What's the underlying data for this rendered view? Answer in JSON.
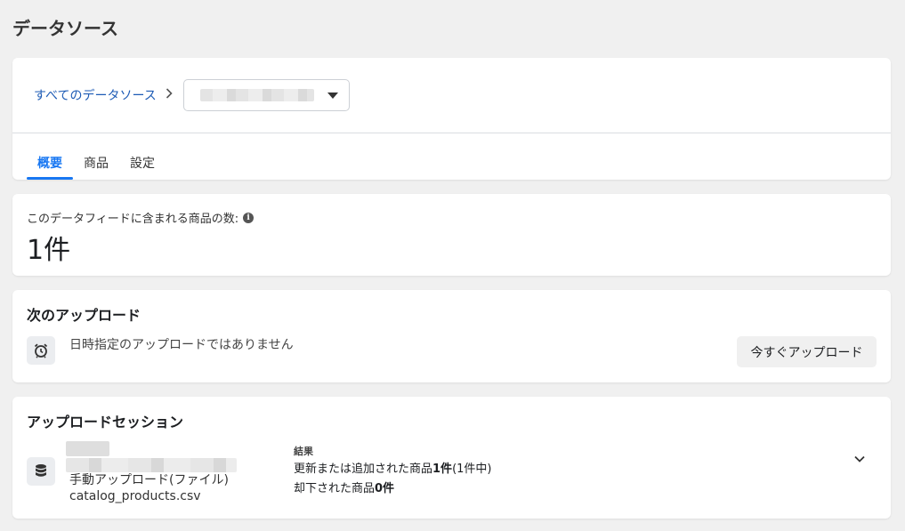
{
  "page": {
    "title": "データソース"
  },
  "header": {
    "breadcrumb_link": "すべてのデータソース",
    "source_select_value": ""
  },
  "tabs": [
    {
      "label": "概要",
      "active": true
    },
    {
      "label": "商品",
      "active": false
    },
    {
      "label": "設定",
      "active": false
    }
  ],
  "count": {
    "label": "このデータフィードに含まれる商品の数:",
    "value": "1件"
  },
  "next_upload": {
    "title": "次のアップロード",
    "status": "日時指定のアップロードではありません",
    "button": "今すぐアップロード"
  },
  "session": {
    "title": "アップロードセッション",
    "method": "手動アップロード(ファイル)",
    "file": "catalog_products.csv",
    "results_label": "結果",
    "updated_prefix": "更新または追加された商品",
    "updated_count": "1件",
    "updated_suffix": "(1件中)",
    "rejected_prefix": "却下された商品",
    "rejected_count": "0件"
  },
  "colors": {
    "accent": "#1877f2",
    "link": "#1d5bb5",
    "background": "#f0f0f0"
  },
  "icons": [
    "chevron-right-icon",
    "caret-down-icon",
    "info-icon",
    "alarm-clock-icon",
    "database-icon",
    "chevron-down-icon"
  ]
}
